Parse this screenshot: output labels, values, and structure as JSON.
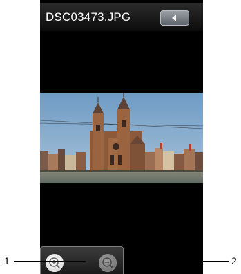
{
  "title_bar": {
    "file_name": "DSC03473.JPG",
    "back_icon": "back-arrow-icon"
  },
  "photo": {
    "subject": "church-photo"
  },
  "zoom_toolbar": {
    "zoom_in_icon": "zoom-in-icon",
    "zoom_out_icon": "zoom-out-icon"
  },
  "callouts": {
    "one": "1",
    "two": "2"
  },
  "colors": {
    "screen_background": "#000000",
    "page_background": "#ffffff",
    "button_gradient_top": "#9a9ea5"
  }
}
